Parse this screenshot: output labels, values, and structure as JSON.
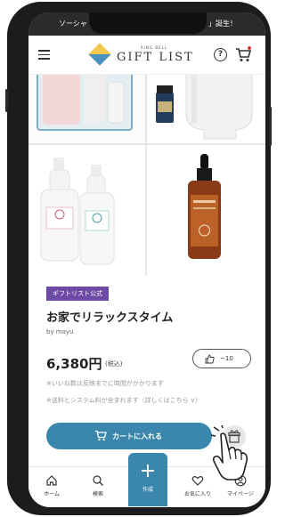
{
  "status_bar": {
    "left_text": "ソーシャ",
    "right_text": "」誕生！"
  },
  "header": {
    "logo_small": "RING BELL",
    "logo_text": "GIFT LIST"
  },
  "product": {
    "tag": "ギフトリスト公式",
    "title": "お家でリラックスタイム",
    "author": "by mayu",
    "price": "6,380円",
    "tax_label": "(税込)",
    "like_count": "~10",
    "note_likes": "※いいね数は反映までに時間がかかります",
    "note_shipping": "※送料とシステム料が含まれます（詳しくはこちら ∨）",
    "add_to_cart_label": "カートに入れる"
  },
  "bottom_nav": {
    "home": "ホーム",
    "search": "検索",
    "create": "作成",
    "favorites": "お気に入り",
    "mypage": "マイページ"
  },
  "colors": {
    "accent": "#3a86ad",
    "tag": "#6d4aa3",
    "notification": "#e53935"
  }
}
